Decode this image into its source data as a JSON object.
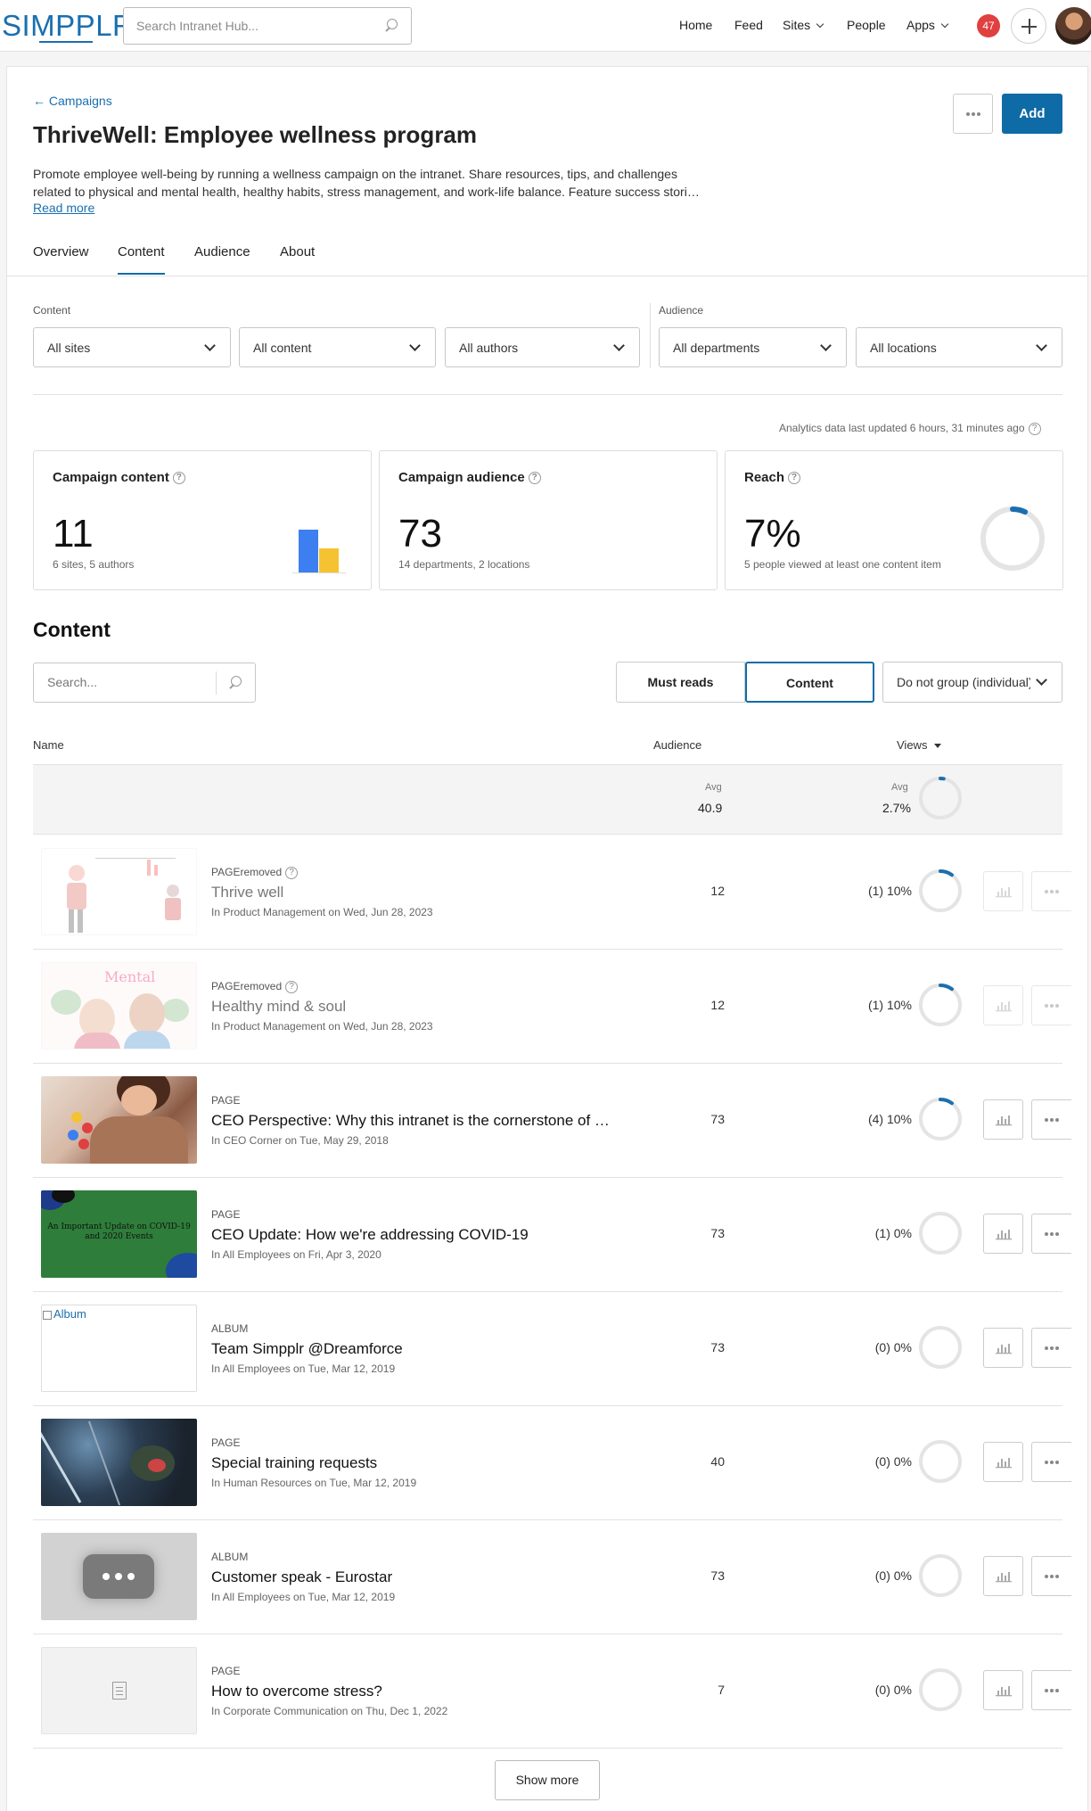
{
  "topbar": {
    "logo": "SIMPPLR",
    "search_placeholder": "Search Intranet Hub...",
    "nav": [
      {
        "label": "Home"
      },
      {
        "label": "Feed"
      },
      {
        "label": "Sites"
      },
      {
        "label": "People"
      },
      {
        "label": "Apps"
      }
    ],
    "notification_count": "47"
  },
  "header": {
    "back_label": "Campaigns",
    "title": "ThriveWell: Employee wellness program",
    "description_line1": "Promote employee well-being by running a wellness campaign on the intranet. Share resources, tips, and challenges",
    "description_line2": "related to physical and mental health, healthy habits, stress management, and work-life balance. Feature success stori…",
    "read_more": "Read more",
    "add_label": "Add"
  },
  "tabs": [
    "Overview",
    "Content",
    "Audience",
    "About"
  ],
  "active_tab": "Content",
  "filters": {
    "content_label": "Content",
    "audience_label": "Audience",
    "sites": "All sites",
    "content": "All content",
    "authors": "All authors",
    "departments": "All departments",
    "locations": "All locations"
  },
  "analytics_note": "Analytics data last updated 6 hours, 31 minutes ago",
  "stats": {
    "campaign_content": {
      "title": "Campaign content",
      "value": "11",
      "sub": "6 sites, 5 authors"
    },
    "campaign_audience": {
      "title": "Campaign audience",
      "value": "73",
      "sub": "14 departments, 2 locations"
    },
    "reach": {
      "title": "Reach",
      "value": "7%",
      "sub": "5 people viewed at least one content item",
      "fraction": 0.07
    }
  },
  "content_section": {
    "title": "Content",
    "search_placeholder": "Search...",
    "must_reads": "Must reads",
    "content_toggle": "Content",
    "group_by": "Do not group (individual)",
    "col_name": "Name",
    "col_audience": "Audience",
    "col_views": "Views",
    "avg_label": "Avg",
    "avg_audience": "40.9",
    "avg_views": "2.7%",
    "avg_views_fraction": 0.027
  },
  "rows": [
    {
      "type": "PAGE",
      "status": "removed",
      "title": "Thrive well",
      "meta": "In Product Management on Wed, Jun 28, 2023",
      "audience": "12",
      "views": "(1) 10%",
      "fraction": 0.1,
      "thumb": "illustration-people"
    },
    {
      "type": "PAGE",
      "status": "removed",
      "title": "Healthy mind & soul",
      "meta": "In Product Management on Wed, Jun 28, 2023",
      "audience": "12",
      "views": "(1) 10%",
      "fraction": 0.1,
      "thumb": "illustration-mental"
    },
    {
      "type": "PAGE",
      "status": "",
      "title": "CEO Perspective: Why this intranet is the cornerstone of our culture",
      "meta": "In CEO Corner on Tue, May 29, 2018",
      "audience": "73",
      "views": "(4) 10%",
      "fraction": 0.1,
      "thumb": "photo-phone"
    },
    {
      "type": "PAGE",
      "status": "",
      "title": "CEO Update: How we're addressing COVID-19",
      "meta": "In All Employees on Fri, Apr 3, 2020",
      "audience": "73",
      "views": "(1) 0%",
      "fraction": 0,
      "thumb": "green-banner",
      "thumb_text": "An Important Update on COVID-19 and 2020 Events"
    },
    {
      "type": "ALBUM",
      "status": "",
      "title": "Team Simpplr @Dreamforce",
      "meta": "In All Employees on Tue, Mar 12, 2019",
      "audience": "73",
      "views": "(0) 0%",
      "fraction": 0,
      "thumb": "broken-image",
      "thumb_alt": "Album"
    },
    {
      "type": "PAGE",
      "status": "",
      "title": "Special training requests",
      "meta": "In Human Resources on Tue, Mar 12, 2019",
      "audience": "40",
      "views": "(0) 0%",
      "fraction": 0,
      "thumb": "photo-dark"
    },
    {
      "type": "ALBUM",
      "status": "",
      "title": "Customer speak - Eurostar",
      "meta": "In All Employees on Tue, Mar 12, 2019",
      "audience": "73",
      "views": "(0) 0%",
      "fraction": 0,
      "thumb": "video-placeholder"
    },
    {
      "type": "PAGE",
      "status": "",
      "title": "How to overcome stress?",
      "meta": "In Corporate Communication on Thu, Dec 1, 2022",
      "audience": "7",
      "views": "(0) 0%",
      "fraction": 0,
      "thumb": "page-icon"
    }
  ],
  "show_more": "Show more",
  "colors": {
    "accent": "#0f6ba6",
    "badge": "#e04040",
    "bar_blue": "#3d7ff0",
    "bar_yellow": "#f5c331"
  }
}
